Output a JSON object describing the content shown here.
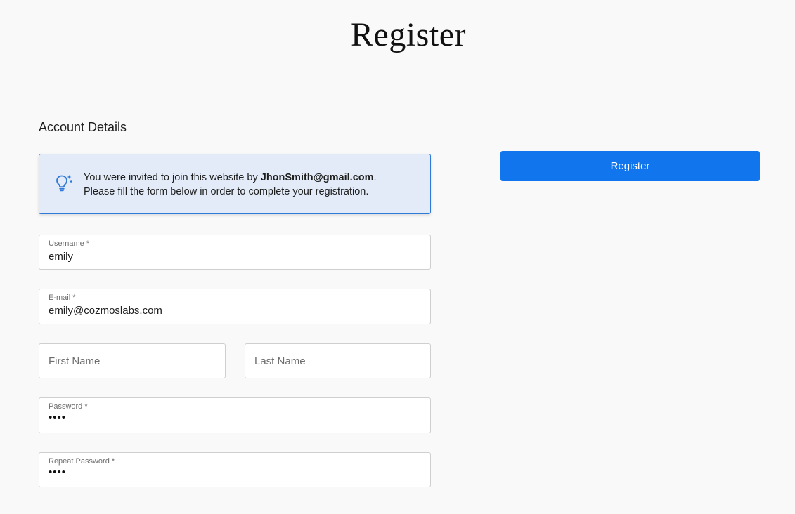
{
  "page": {
    "title": "Register"
  },
  "form": {
    "section_heading": "Account Details",
    "notice": {
      "icon": "lightbulb-sparkle-icon",
      "line1_prefix": "You were invited to join this website by ",
      "line1_email": "JhonSmith@gmail.com",
      "line1_suffix": ".",
      "line2": "Please fill the form below in order to complete your registration."
    },
    "username": {
      "label": "Username *",
      "value": "emily"
    },
    "email": {
      "label": "E-mail *",
      "value": "emily@cozmoslabs.com"
    },
    "first_name": {
      "placeholder": "First Name"
    },
    "last_name": {
      "placeholder": "Last Name"
    },
    "password": {
      "label": "Password *",
      "value": "••••"
    },
    "repeat_password": {
      "label": "Repeat Password *",
      "value": "••••"
    }
  },
  "actions": {
    "register_label": "Register"
  },
  "colors": {
    "accent": "#1176ee",
    "notice_background": "#e2ebf7",
    "notice_border": "#2f7ad6",
    "page_background": "#f9f9f9"
  }
}
